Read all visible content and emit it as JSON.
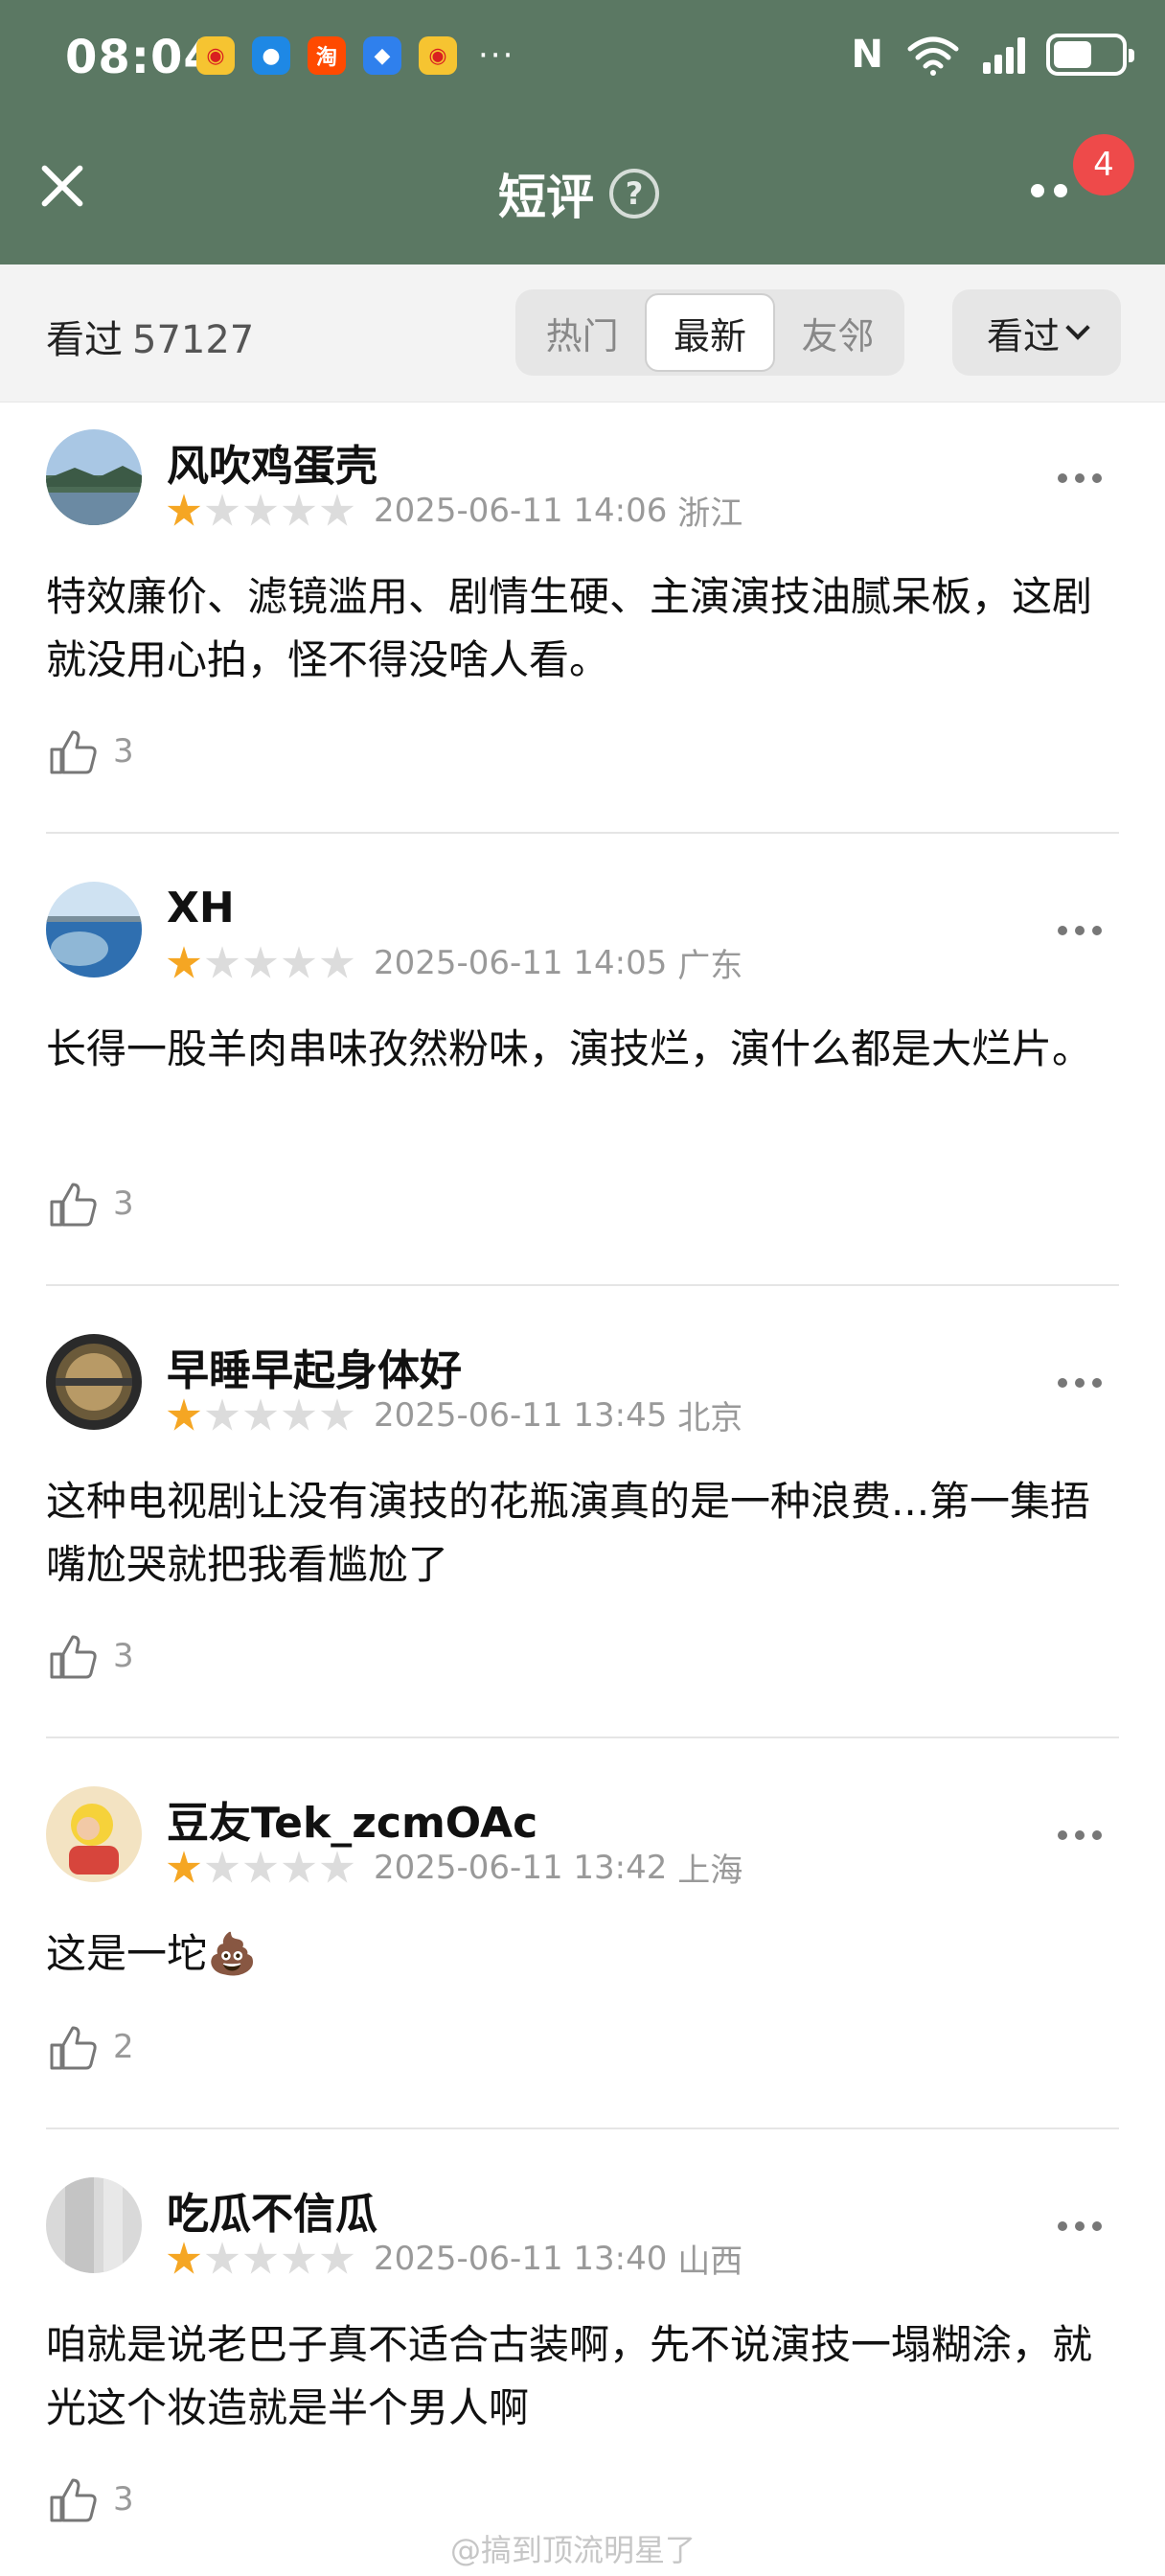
{
  "status_bar": {
    "time": "08:04",
    "more_indicator": "···",
    "network": "N",
    "notification_icons": [
      "weibo-icon",
      "message-icon",
      "taobao-icon",
      "shield-icon",
      "weibo-icon"
    ]
  },
  "header": {
    "title": "短评",
    "help_label": "?",
    "badge_count": "4",
    "bg_color": "#5b7863"
  },
  "filter": {
    "seen_label": "看过",
    "seen_count": "57127",
    "tabs": [
      {
        "label": "热门",
        "active": false
      },
      {
        "label": "最新",
        "active": true
      },
      {
        "label": "友邻",
        "active": false
      }
    ],
    "sort_label": "看过"
  },
  "reviews": [
    {
      "user": "风吹鸡蛋壳",
      "rating": 1,
      "time": "2025-06-11 14:06",
      "location": "浙江",
      "text": "特效廉价、滤镜滥用、剧情生硬、主演演技油腻呆板，这剧就没用心拍，怪不得没啥人看。",
      "likes": "3"
    },
    {
      "user": "XH",
      "rating": 1,
      "time": "2025-06-11 14:05",
      "location": "广东",
      "text": "长得一股羊肉串味孜然粉味，演技烂，演什么都是大烂片。",
      "likes": "3"
    },
    {
      "user": "早睡早起身体好",
      "rating": 1,
      "time": "2025-06-11 13:45",
      "location": "北京",
      "text": "这种电视剧让没有演技的花瓶演真的是一种浪费...第一集捂嘴尬哭就把我看尴尬了",
      "likes": "3"
    },
    {
      "user": "豆友Tek_zcmOAc",
      "rating": 1,
      "time": "2025-06-11 13:42",
      "location": "上海",
      "text": "这是一坨💩",
      "likes": "2"
    },
    {
      "user": "吃瓜不信瓜",
      "rating": 1,
      "time": "2025-06-11 13:40",
      "location": "山西",
      "text": "咱就是说老巴子真不适合古装啊，先不说演技一塌糊涂，就光这个妆造就是半个男人啊",
      "likes": "3"
    }
  ],
  "watermark": "@搞到顶流明星了",
  "colors": {
    "star_on": "#f5a623",
    "star_off": "#dcdcdc",
    "badge": "#ee4a4a"
  }
}
